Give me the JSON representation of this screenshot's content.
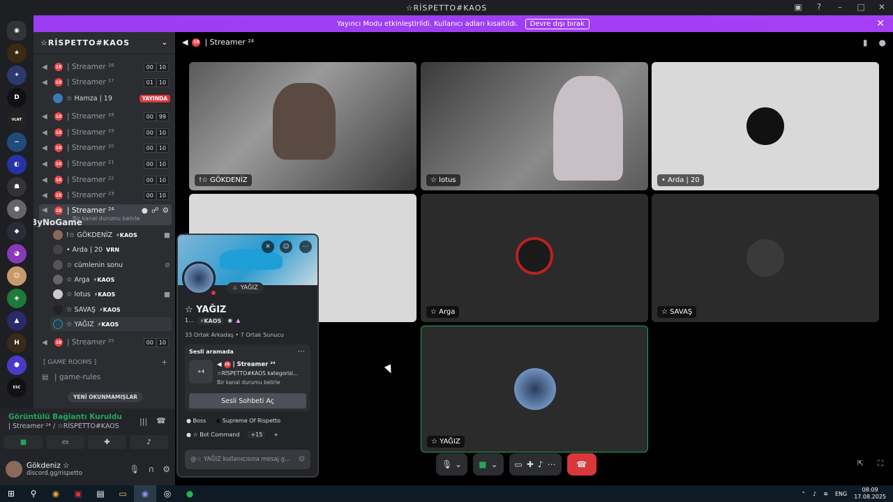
{
  "window_title": "☆RİSPETTO#KAOS",
  "banner": {
    "text": "Yayıncı Modu etkinleştirildi. Kullanıcı adları kısaltıldı.",
    "button": "Devre dışı bırak"
  },
  "server": {
    "name": "☆RİSPETTO#KAOS"
  },
  "channels": [
    {
      "name": "| Streamer ¹⁶",
      "a": "00",
      "b": "10"
    },
    {
      "name": "| Streamer ¹⁷",
      "a": "01",
      "b": "10"
    },
    {
      "name": "| Streamer ¹⁸",
      "a": "00",
      "b": "99"
    },
    {
      "name": "| Streamer ¹⁹",
      "a": "00",
      "b": "10"
    },
    {
      "name": "| Streamer ²⁰",
      "a": "00",
      "b": "10"
    },
    {
      "name": "| Streamer ²¹",
      "a": "00",
      "b": "10"
    },
    {
      "name": "| Streamer ²²",
      "a": "00",
      "b": "10"
    },
    {
      "name": "| Streamer ²³",
      "a": "00",
      "b": "10"
    }
  ],
  "hamza": {
    "name": "☆ Hamza | 19",
    "badge": "YAYINDA"
  },
  "active_channel": {
    "name": "| Streamer ²⁴",
    "status": "Bir kanal durumu belirle"
  },
  "members": [
    {
      "name": "!☆ GÖKDENİZ",
      "tag": "⚡KAOS"
    },
    {
      "name": "• Arda | 20",
      "tag": "VRN"
    },
    {
      "name": "☆ cümlenin sonu",
      "tag": ""
    },
    {
      "name": "☆ Arga",
      "tag": "⚡KAOS"
    },
    {
      "name": "☆ lotus",
      "tag": "⚡KAOS"
    },
    {
      "name": "☆ SAVAŞ",
      "tag": "⚡KAOS"
    },
    {
      "name": "☆ YAĞIZ",
      "tag": "⚡KAOS"
    }
  ],
  "channel25": {
    "name": "| Streamer ²⁵",
    "a": "00",
    "b": "10"
  },
  "category": "[ GAME ROOMS ]",
  "game_rules": "| game-rules",
  "unread": "YENİ OKUNMAMIŞLAR",
  "watermark": "ByNoGame",
  "connection": {
    "status": "Görüntülü Bağlantı Kuruldu",
    "sub": "| Streamer ²⁴ / ☆RİSPETTO#KAOS"
  },
  "user": {
    "name": "Gökdeniz ☆",
    "status": "discord.gg/rispetto"
  },
  "main_title": "| Streamer ²⁴",
  "tiles": [
    {
      "name": "!☆ GÖKDENİZ"
    },
    {
      "name": "☆ lotus"
    },
    {
      "name": "• Arda | 20"
    },
    {
      "name": "☆ Arga"
    },
    {
      "name": "☆ SAVAŞ"
    },
    {
      "name": "☆ YAĞIZ"
    }
  ],
  "popup": {
    "activity": "YAĞIZ",
    "name": "☆ YAĞIZ",
    "tag_prefix": "1...",
    "tag": "⚡KAOS",
    "mutuals": "33 Ortak Arkadaş • 7 Ortak Sunucu",
    "voice_header": "Sesli aramada",
    "voice_channel": "| Streamer ²⁴",
    "voice_sub": "☆RİSPETTO#KAOS kategorisi...",
    "voice_status": "Bir kanal durumu belirle",
    "plus_count": "+4",
    "join_btn": "Sesli Sohbeti Aç",
    "roles": [
      "Boss",
      "Supreme Of Rispetto",
      "☆ Bot Command"
    ],
    "role_more": "+15",
    "message_placeholder": "@☆ YAĞIZ kullanıcısına mesaj g..."
  },
  "tray": {
    "lang": "ENG",
    "time": "08:09",
    "date": "17.08.2025"
  },
  "colors": {
    "accent": "#5865f2",
    "banner": "#a53ff5",
    "danger": "#da373c",
    "online": "#23a55a"
  }
}
